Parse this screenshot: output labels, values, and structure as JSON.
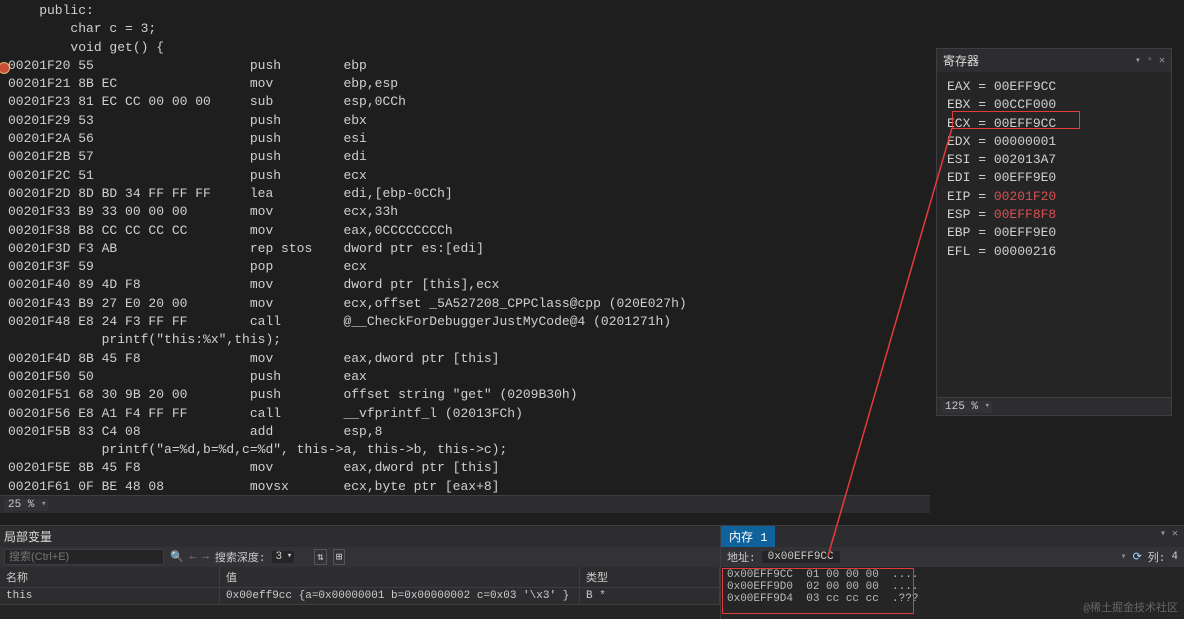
{
  "editor": {
    "src_lines": [
      "    public:",
      "        char c = 3;",
      "        void get() {"
    ],
    "asm": [
      {
        "addr": "00201F20",
        "bytes": "55",
        "op": "push",
        "args": "ebp"
      },
      {
        "addr": "00201F21",
        "bytes": "8B EC",
        "op": "mov",
        "args": "ebp,esp"
      },
      {
        "addr": "00201F23",
        "bytes": "81 EC CC 00 00 00",
        "op": "sub",
        "args": "esp,0CCh"
      },
      {
        "addr": "00201F29",
        "bytes": "53",
        "op": "push",
        "args": "ebx"
      },
      {
        "addr": "00201F2A",
        "bytes": "56",
        "op": "push",
        "args": "esi"
      },
      {
        "addr": "00201F2B",
        "bytes": "57",
        "op": "push",
        "args": "edi"
      },
      {
        "addr": "00201F2C",
        "bytes": "51",
        "op": "push",
        "args": "ecx"
      },
      {
        "addr": "00201F2D",
        "bytes": "8D BD 34 FF FF FF",
        "op": "lea",
        "args": "edi,[ebp-0CCh]"
      },
      {
        "addr": "00201F33",
        "bytes": "B9 33 00 00 00",
        "op": "mov",
        "args": "ecx,33h"
      },
      {
        "addr": "00201F38",
        "bytes": "B8 CC CC CC CC",
        "op": "mov",
        "args": "eax,0CCCCCCCCh"
      },
      {
        "addr": "00201F3D",
        "bytes": "F3 AB",
        "op": "rep stos",
        "args": "dword ptr es:[edi]"
      },
      {
        "addr": "00201F3F",
        "bytes": "59",
        "op": "pop",
        "args": "ecx"
      },
      {
        "addr": "00201F40",
        "bytes": "89 4D F8",
        "op": "mov",
        "args": "dword ptr [this],ecx"
      },
      {
        "addr": "00201F43",
        "bytes": "B9 27 E0 20 00",
        "op": "mov",
        "args": "ecx,offset _5A527208_CPPClass@cpp (020E027h)"
      },
      {
        "addr": "00201F48",
        "bytes": "E8 24 F3 FF FF",
        "op": "call",
        "args": "@__CheckForDebuggerJustMyCode@4 (0201271h)"
      },
      {
        "src": "            printf(\"this:%x\",this);"
      },
      {
        "addr": "00201F4D",
        "bytes": "8B 45 F8",
        "op": "mov",
        "args": "eax,dword ptr [this]"
      },
      {
        "addr": "00201F50",
        "bytes": "50",
        "op": "push",
        "args": "eax"
      },
      {
        "addr": "00201F51",
        "bytes": "68 30 9B 20 00",
        "op": "push",
        "args": "offset string \"get\" (0209B30h)"
      },
      {
        "addr": "00201F56",
        "bytes": "E8 A1 F4 FF FF",
        "op": "call",
        "args": "__vfprintf_l (02013FCh)"
      },
      {
        "addr": "00201F5B",
        "bytes": "83 C4 08",
        "op": "add",
        "args": "esp,8"
      },
      {
        "src": "            printf(\"a=%d,b=%d,c=%d\", this->a, this->b, this->c);"
      },
      {
        "addr": "00201F5E",
        "bytes": "8B 45 F8",
        "op": "mov",
        "args": "eax,dword ptr [this]"
      },
      {
        "addr": "00201F61",
        "bytes": "0F BE 48 08",
        "op": "movsx",
        "args": "ecx,byte ptr [eax+8]"
      }
    ],
    "zoom": "25 %"
  },
  "registers": {
    "title": "寄存器",
    "zoom": "125 %",
    "rows": [
      {
        "name": "EAX",
        "val": "00EFF9CC",
        "hot": false
      },
      {
        "name": "EBX",
        "val": "00CCF000",
        "hot": false
      },
      {
        "name": "ECX",
        "val": "00EFF9CC",
        "hot": false,
        "boxed": true
      },
      {
        "name": "EDX",
        "val": "00000001",
        "hot": false
      },
      {
        "name": "ESI",
        "val": "002013A7",
        "hot": false
      },
      {
        "name": "EDI",
        "val": "00EFF9E0",
        "hot": false
      },
      {
        "name": "EIP",
        "val": "00201F20",
        "hot": true
      },
      {
        "name": "ESP",
        "val": "00EFF8F8",
        "hot": true
      },
      {
        "name": "EBP",
        "val": "00EFF9E0",
        "hot": false
      },
      {
        "name": "EFL",
        "val": "00000216",
        "hot": false
      }
    ]
  },
  "locals": {
    "title": "局部变量",
    "search_ph": "搜索(Ctrl+E)",
    "depth_label": "搜索深度:",
    "depth_value": "3",
    "columns": [
      "名称",
      "值",
      "类型"
    ],
    "rows": [
      {
        "name": "this",
        "value": "0x00eff9cc {a=0x00000001 b=0x00000002 c=0x03 '\\x3' }",
        "type": "B *"
      }
    ]
  },
  "memory": {
    "tab": "内存 1",
    "addr_label": "地址:",
    "addr_value": "0x00EFF9CC",
    "col_label": "列:",
    "col_value": "4",
    "rows": [
      {
        "addr": "0x00EFF9CC",
        "bytes": "01 00 00 00",
        "ascii": "...."
      },
      {
        "addr": "0x00EFF9D0",
        "bytes": "02 00 00 00",
        "ascii": "...."
      },
      {
        "addr": "0x00EFF9D4",
        "bytes": "03 cc cc cc",
        "ascii": ".???"
      }
    ]
  },
  "watermark": "@稀土掘金技术社区"
}
